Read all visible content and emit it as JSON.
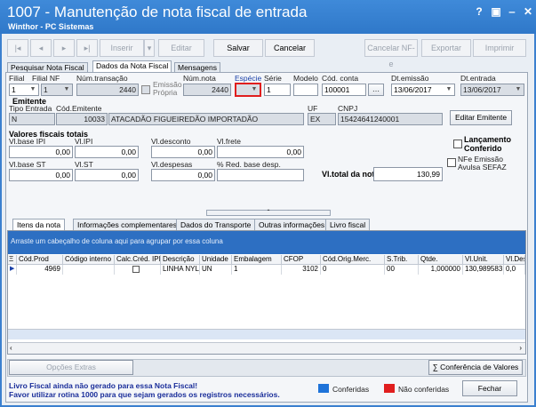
{
  "window": {
    "title": "1007 - Manutenção de nota fiscal de entrada",
    "subtitle": "Winthor - PC Sistemas",
    "controls": [
      "?",
      "▣",
      "‒",
      "✕"
    ]
  },
  "toolbar": {
    "first": "|◂",
    "prev": "◂",
    "next": "▸",
    "last": "▸|",
    "insert": "Inserir",
    "edit": "Editar",
    "save": "Salvar",
    "cancel": "Cancelar",
    "cancel_nfe": "Cancelar NF-e",
    "export": "Exportar",
    "print": "Imprimir"
  },
  "tabs": [
    "Pesquisar Nota Fiscal",
    "Dados da Nota Fiscal",
    "Mensagens"
  ],
  "header": {
    "filial_label": "Filial",
    "filial_value": "1",
    "filial_nf_label": "Filial NF",
    "filial_nf_value": "1",
    "num_transacao_label": "Núm.transação",
    "num_transacao_value": "2440",
    "emissao_propria": "Emissão Própria",
    "num_nota_label": "Núm.nota",
    "num_nota_value": "2440",
    "especie_label": "Espécie",
    "serie_label": "Série",
    "serie_value": "1",
    "modelo_label": "Modelo",
    "cod_conta_label": "Cód. conta",
    "cod_conta_value": "100001",
    "dt_emissao_label": "Dt.emissão",
    "dt_emissao_value": "13/06/2017",
    "dt_entrada_label": "Dt.entrada",
    "dt_entrada_value": "13/06/2017"
  },
  "emitente": {
    "section": "Emitente",
    "tipo_entrada_label": "Tipo Entrada",
    "tipo_entrada_value": "N",
    "cod_emitente_label": "Cód.Emitente",
    "cod_emitente_value": "10033",
    "nome_value": "ATACADÃO FIGUEIREDÃO IMPORTADÃO",
    "uf_label": "UF",
    "uf_value": "EX",
    "cnpj_label": "CNPJ",
    "cnpj_value": "15424641240001",
    "edit_button": "Editar Emitente"
  },
  "valores": {
    "section": "Valores fiscais totais",
    "vl_base_ipi_label": "Vl.base IPI",
    "vl_base_ipi": "0,00",
    "vl_ipi_label": "Vl.IPI",
    "vl_ipi": "0,00",
    "vl_desconto_label": "Vl.desconto",
    "vl_desconto": "0,00",
    "vl_frete_label": "Vl.frete",
    "vl_frete": "0,00",
    "vl_base_st_label": "Vl.base ST",
    "vl_base_st": "0,00",
    "vl_st_label": "Vl.ST",
    "vl_st": "0,00",
    "vl_despesas_label": "Vl.despesas",
    "vl_despesas": "0,00",
    "red_base_label": "% Red. base desp.",
    "red_base": "",
    "vl_total_label": "Vl.total da nota:",
    "vl_total": "130,99",
    "lancamento_conferido": "Lançamento Conferido",
    "nfe_emissao_avulsa": "NFe Emissão Avulsa SEFAZ"
  },
  "inner_tabs": [
    "Itens da nota",
    "Informações complementares",
    "Dados do Transporte",
    "Outras informações",
    "Livro fiscal"
  ],
  "grid": {
    "group_hint": "Arraste um cabeçalho de coluna aqui para agrupar por essa coluna",
    "columns": [
      "Cód.Prod",
      "Código interno",
      "Calc.Créd. IPI",
      "Descrição",
      "Unidade",
      "Embalagem",
      "CFOP",
      "Cód.Orig.Merc.",
      "S.Trib.",
      "Qtde.",
      "Vl.Unit.",
      "Vl.Desc"
    ],
    "rows": [
      [
        "4969",
        "",
        "",
        "LINHA NYLO",
        "UN",
        "1",
        "3102",
        "0",
        "00",
        "1,000000",
        "130,989583",
        "0,0"
      ]
    ]
  },
  "footer": {
    "opcoes_extras": "Opções Extras",
    "conferencia": "Conferência de Valores",
    "warning_line1": "Livro Fiscal ainda não gerado para essa Nota Fiscal!",
    "warning_line2": "Favor utilizar rotina 1000 para que sejam gerados os registros necessários.",
    "legend_conferidas": "Conferidas",
    "legend_nao_conferidas": "Não conferidas",
    "fechar": "Fechar"
  },
  "colors": {
    "title_blue": "#2f78c9",
    "grid_header_blue": "#2d6fc2",
    "legend_blue": "#1e73d9",
    "legend_red": "#e01e1e",
    "warning_text": "#1a2e9a"
  }
}
